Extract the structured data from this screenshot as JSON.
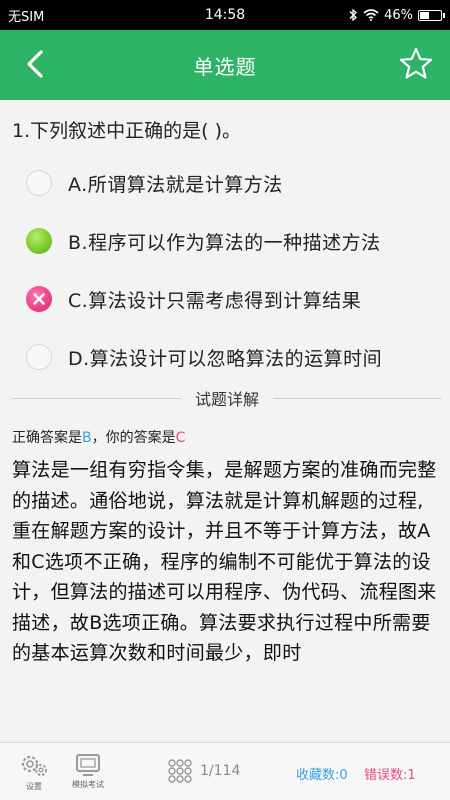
{
  "status_bar": {
    "carrier": "无SIM",
    "time": "14:58",
    "battery_percent": "46%",
    "battery_level": 0.46
  },
  "header": {
    "title": "单选题",
    "back_icon": "chevron-left-icon",
    "favorite_icon": "star-outline-icon"
  },
  "question": {
    "text": "1.下列叙述中正确的是( )。",
    "options": [
      {
        "label": "A.所谓算法就是计算方法",
        "state": "unselected"
      },
      {
        "label": "B.程序可以作为算法的一种描述方法",
        "state": "correct"
      },
      {
        "label": "C.算法设计只需考虑得到计算结果",
        "state": "wrong"
      },
      {
        "label": "D.算法设计可以忽略算法的运算时间",
        "state": "unselected"
      }
    ]
  },
  "explanation": {
    "section_title": "试题详解",
    "correct_prefix": "正确答案是",
    "correct_answer": "B",
    "separator": "，",
    "yours_prefix": "你的答案是",
    "your_answer": "C",
    "body": "算法是一组有穷指令集，是解题方案的准确而完整的描述。通俗地说，算法就是计算机解题的过程,重在解题方案的设计，并且不等于计算方法，故A和C选项不正确，程序的编制不可能优于算法的设计，但算法的描述可以用程序、伪代码、流程图来描述，故B选项正确。算法要求执行过程中所需要的基本运算次数和时间最少，即时"
  },
  "footer": {
    "settings_label": "设置",
    "exam_label": "模拟考试",
    "progress": "1/114",
    "favorites": "收藏数:0",
    "errors": "错误数:1"
  },
  "colors": {
    "header_green": "#2db366",
    "correct_blue": "#3aa0e0",
    "wrong_pink": "#e84a7a"
  }
}
